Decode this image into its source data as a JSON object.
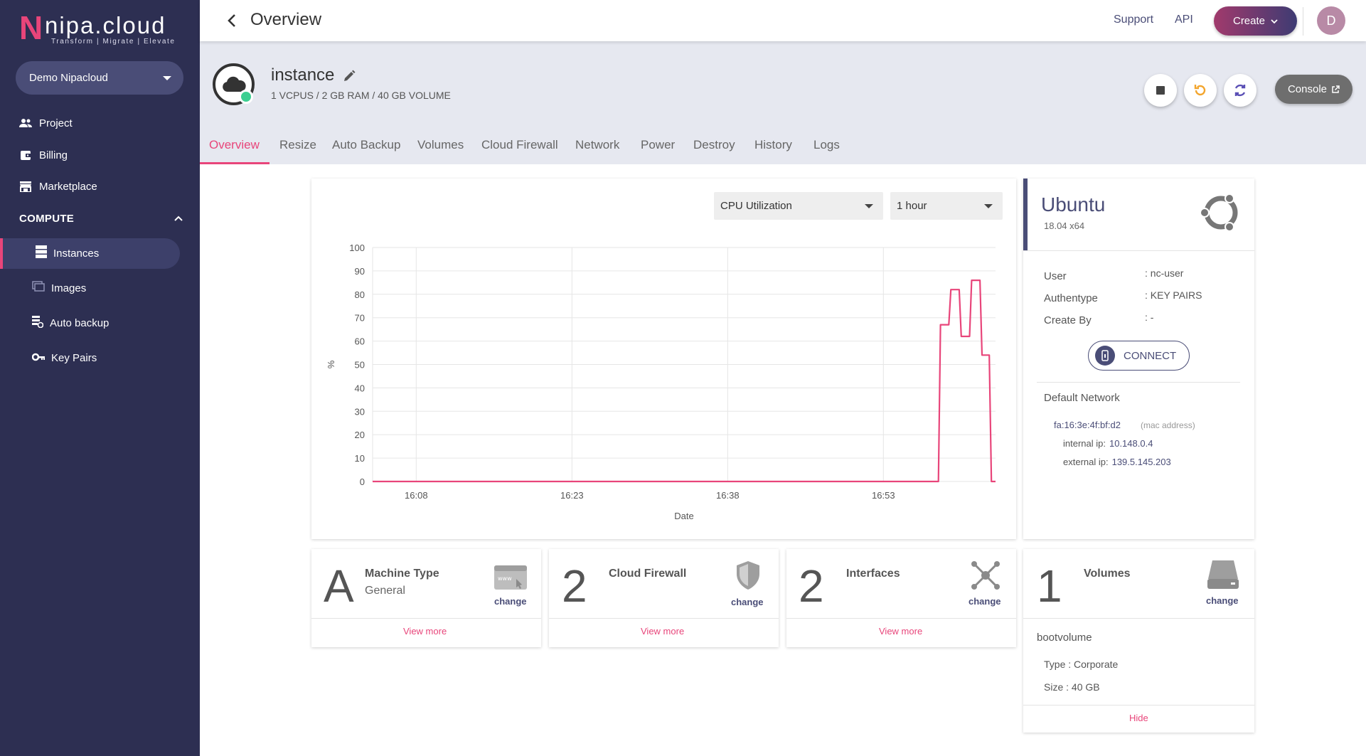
{
  "brand": {
    "mark": "N",
    "name": "nipa.cloud",
    "tagline": "Transform  |  Migrate  |  Elevate"
  },
  "sidebar": {
    "project": "Demo Nipacloud",
    "items": [
      {
        "label": "Project",
        "icon": "users-icon"
      },
      {
        "label": "Billing",
        "icon": "wallet-icon"
      },
      {
        "label": "Marketplace",
        "icon": "store-icon"
      }
    ],
    "section": "COMPUTE",
    "sub_items": [
      {
        "label": "Instances",
        "icon": "server-icon",
        "active": true
      },
      {
        "label": "Images",
        "icon": "images-icon"
      },
      {
        "label": "Auto backup",
        "icon": "backup-icon"
      },
      {
        "label": "Key Pairs",
        "icon": "key-icon"
      }
    ]
  },
  "header": {
    "title": "Overview",
    "support": "Support",
    "api": "API",
    "create": "Create",
    "avatar": "D"
  },
  "instance": {
    "name": "instance",
    "spec": "1 VCPUS / 2 GB RAM / 40 GB VOLUME",
    "status_color": "#3ccf91",
    "console": "Console"
  },
  "tabs": [
    "Overview",
    "Resize",
    "Auto Backup",
    "Volumes",
    "Cloud Firewall",
    "Network",
    "Power",
    "Destroy",
    "History",
    "Logs"
  ],
  "chart_controls": {
    "metric": "CPU Utilization",
    "range": "1 hour"
  },
  "chart_data": {
    "type": "line",
    "xlabel": "Date",
    "ylabel": "%",
    "ylim": [
      0,
      100
    ],
    "yticks": [
      0,
      10,
      20,
      30,
      40,
      50,
      60,
      70,
      80,
      90,
      100
    ],
    "xticks": [
      "16:08",
      "16:23",
      "16:38",
      "16:53"
    ],
    "xticks_min": [
      8,
      23,
      38,
      53
    ],
    "xlim_min": [
      3.8,
      63.8
    ],
    "grid": true,
    "color": "#e8457a",
    "points": [
      [
        3.8,
        0
      ],
      [
        58.3,
        0
      ],
      [
        58.5,
        67
      ],
      [
        59.3,
        67
      ],
      [
        59.5,
        82
      ],
      [
        60.3,
        82
      ],
      [
        60.5,
        62
      ],
      [
        61.3,
        62
      ],
      [
        61.5,
        86
      ],
      [
        62.3,
        86
      ],
      [
        62.5,
        54
      ],
      [
        63.2,
        54
      ],
      [
        63.4,
        0
      ],
      [
        63.8,
        0
      ]
    ]
  },
  "os": {
    "name": "Ubuntu",
    "version": "18.04 x64",
    "user_label": "User",
    "user": ": nc-user",
    "auth_label": "Authentype",
    "auth": ": KEY PAIRS",
    "create_label": "Create By",
    "create": ": -",
    "connect": "CONNECT",
    "network_title": "Default Network",
    "mac": "fa:16:3e:4f:bf:d2",
    "mac_label": "(mac address)",
    "internal_label": "internal ip:",
    "internal_ip": "10.148.0.4",
    "external_label": "external ip:",
    "external_ip": "139.5.145.203"
  },
  "stats": [
    {
      "big": "A",
      "title": "Machine Type",
      "sub": "General",
      "change": "change",
      "more": "View more",
      "icon": "browser-window-icon"
    },
    {
      "big": "2",
      "title": "Cloud Firewall",
      "sub": "",
      "change": "change",
      "more": "View more",
      "icon": "shield-icon"
    },
    {
      "big": "2",
      "title": "Interfaces",
      "sub": "",
      "change": "change",
      "more": "View more",
      "icon": "network-hub-icon"
    },
    {
      "big": "1",
      "title": "Volumes",
      "sub": "",
      "change": "change",
      "more": "",
      "icon": "hard-drive-icon"
    }
  ],
  "volume": {
    "name": "bootvolume",
    "type": "Type : Corporate",
    "size": "Size : 40 GB",
    "hide": "Hide"
  },
  "colors": {
    "sidebar": "#2d2f52",
    "accent": "#e8457a",
    "primary": "#4a4d77"
  }
}
